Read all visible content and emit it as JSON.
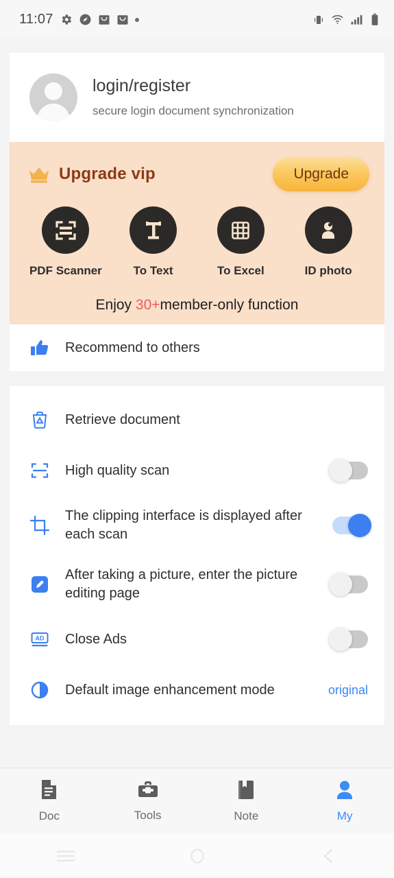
{
  "status_bar": {
    "time": "11:07",
    "left_icons": [
      "gear-icon",
      "compass-icon",
      "mail-icon",
      "mail-icon",
      "dot-icon"
    ],
    "right_icons": [
      "vibrate-icon",
      "wifi-icon",
      "signal-icon",
      "battery-icon"
    ]
  },
  "profile": {
    "title": "login/register",
    "subtitle": "secure login document synchronization",
    "avatar_icon": "person-avatar-icon"
  },
  "vip": {
    "title": "Upgrade vip",
    "crown_icon": "crown-icon",
    "upgrade_button": "Upgrade",
    "background_color": "#fadfc9",
    "title_color": "#8c3a17",
    "tools": [
      {
        "label": "PDF Scanner",
        "icon": "scan-frame-icon"
      },
      {
        "label": "To Text",
        "icon": "text-t-icon"
      },
      {
        "label": "To Excel",
        "icon": "grid-table-icon"
      },
      {
        "label": "ID photo",
        "icon": "person-bust-icon"
      }
    ],
    "footer_prefix": "Enjoy ",
    "footer_highlight": "30+",
    "footer_suffix": "member-only function",
    "highlight_color": "#f2595c"
  },
  "recommend": {
    "label": "Recommend to others",
    "icon": "thumbs-up-icon"
  },
  "settings": [
    {
      "label": "Retrieve document",
      "icon": "trash-restore-icon",
      "control": "none"
    },
    {
      "label": "High quality scan",
      "icon": "scan-frame-icon",
      "control": "toggle",
      "state": "off"
    },
    {
      "label": "The clipping interface is displayed after each scan",
      "icon": "crop-icon",
      "control": "toggle",
      "state": "on"
    },
    {
      "label": "After taking a picture, enter the picture editing page",
      "icon": "edit-pencil-icon",
      "control": "toggle",
      "state": "off"
    },
    {
      "label": "Close Ads",
      "icon": "ad-badge-icon",
      "control": "toggle",
      "state": "off"
    },
    {
      "label": "Default image enhancement mode",
      "icon": "contrast-circle-icon",
      "control": "value",
      "value": "original"
    }
  ],
  "tabbar": {
    "active": "My",
    "accent_color": "#3b8cf7",
    "items": [
      {
        "label": "Doc",
        "icon": "document-icon"
      },
      {
        "label": "Tools",
        "icon": "toolbox-icon"
      },
      {
        "label": "Note",
        "icon": "book-icon"
      },
      {
        "label": "My",
        "icon": "person-icon"
      }
    ]
  },
  "android_nav": {
    "items": [
      "recents-icon",
      "home-icon",
      "back-icon"
    ]
  }
}
